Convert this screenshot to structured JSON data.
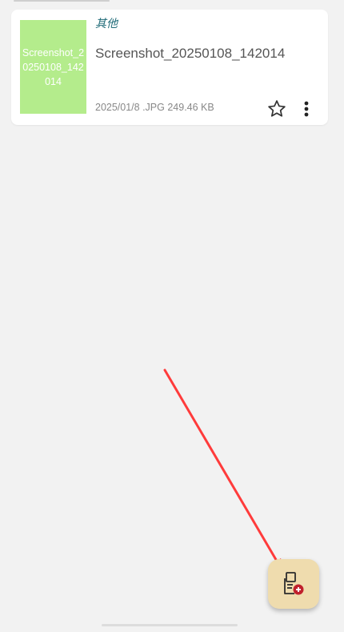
{
  "file_list": {
    "items": [
      {
        "thumbnail_text": "Screenshot_20250108_142014",
        "category": "其他",
        "name": "Screenshot_20250108_142014",
        "meta": "2025/01/8 .JPG 249.46 KB"
      }
    ]
  },
  "icons": {
    "favorite": "star-outline-icon",
    "more": "more-vertical-icon",
    "fab": "add-document-icon"
  },
  "colors": {
    "background": "#f2f2f2",
    "thumbnail": "#b4ec8c",
    "category_text": "#1f6b78",
    "fab_background": "#efdcae",
    "fab_badge": "#c0202c",
    "annotation_arrow": "#ff3b3b"
  }
}
